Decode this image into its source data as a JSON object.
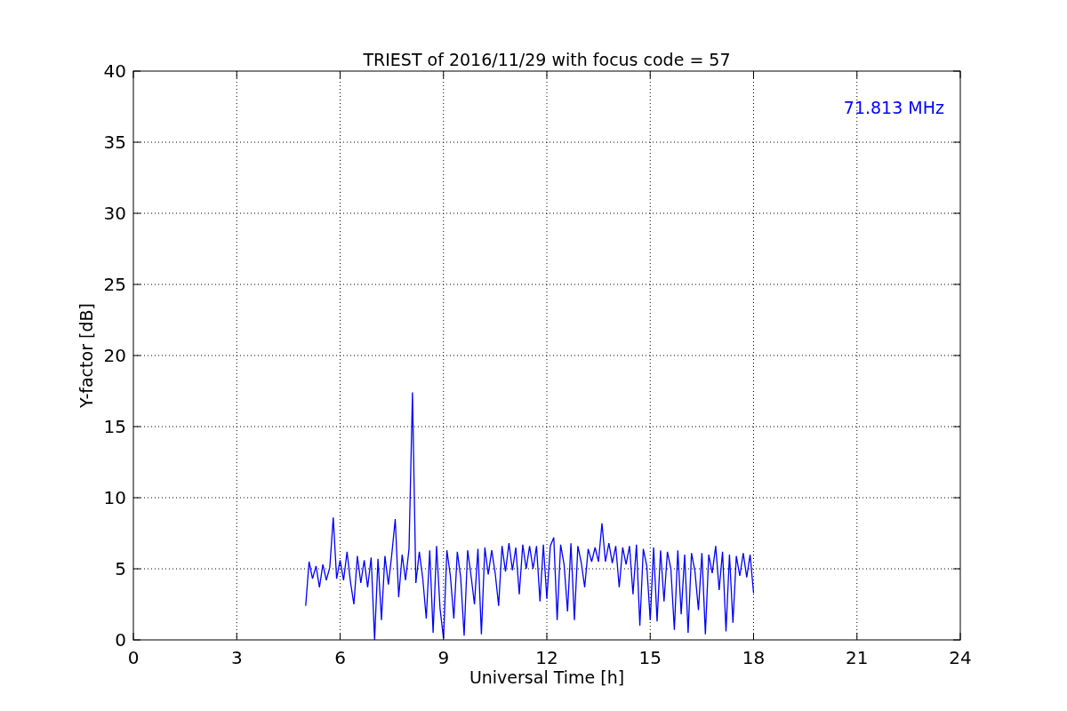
{
  "chart_data": {
    "type": "line",
    "title": "TRIEST of 2016/11/29 with focus code = 57",
    "xlabel": "Universal Time [h]",
    "ylabel": "Y-factor [dB]",
    "xlim": [
      0,
      24
    ],
    "ylim": [
      0,
      40
    ],
    "grid": true,
    "xticks": [
      0,
      3,
      6,
      9,
      12,
      15,
      18,
      21,
      24
    ],
    "yticks": [
      0,
      5,
      10,
      15,
      20,
      25,
      30,
      35,
      40
    ],
    "x": [
      5.0,
      5.1,
      5.2,
      5.3,
      5.4,
      5.5,
      5.6,
      5.7,
      5.8,
      5.9,
      6.0,
      6.1,
      6.2,
      6.3,
      6.4,
      6.5,
      6.6,
      6.7,
      6.8,
      6.9,
      7.0,
      7.1,
      7.2,
      7.3,
      7.4,
      7.5,
      7.6,
      7.7,
      7.8,
      7.9,
      8.0,
      8.1,
      8.2,
      8.3,
      8.4,
      8.5,
      8.6,
      8.7,
      8.8,
      8.9,
      9.0,
      9.1,
      9.2,
      9.3,
      9.4,
      9.5,
      9.6,
      9.7,
      9.8,
      9.9,
      10.0,
      10.1,
      10.2,
      10.3,
      10.4,
      10.5,
      10.6,
      10.7,
      10.8,
      10.9,
      11.0,
      11.1,
      11.2,
      11.3,
      11.4,
      11.5,
      11.6,
      11.7,
      11.8,
      11.9,
      12.0,
      12.1,
      12.2,
      12.3,
      12.4,
      12.5,
      12.6,
      12.7,
      12.8,
      12.9,
      13.0,
      13.1,
      13.2,
      13.3,
      13.4,
      13.5,
      13.6,
      13.7,
      13.8,
      13.9,
      14.0,
      14.1,
      14.2,
      14.3,
      14.4,
      14.5,
      14.6,
      14.7,
      14.8,
      14.9,
      15.0,
      15.1,
      15.2,
      15.3,
      15.4,
      15.5,
      15.6,
      15.7,
      15.8,
      15.9,
      16.0,
      16.1,
      16.2,
      16.3,
      16.4,
      16.5,
      16.6,
      16.7,
      16.8,
      16.9,
      17.0,
      17.1,
      17.2,
      17.3,
      17.4,
      17.5,
      17.6,
      17.7,
      17.8,
      17.9,
      18.0
    ],
    "series": [
      {
        "name": "71.813 MHz",
        "color": "#0000ff",
        "values": [
          2.4,
          5.5,
          4.3,
          5.2,
          3.7,
          5.3,
          4.2,
          5.1,
          8.6,
          4.3,
          5.6,
          4.2,
          6.2,
          4.1,
          2.5,
          5.9,
          4.0,
          5.6,
          3.7,
          5.8,
          0.0,
          5.7,
          1.4,
          5.9,
          3.9,
          6.0,
          8.5,
          3.0,
          6.0,
          4.2,
          6.4,
          17.4,
          4.0,
          6.2,
          4.3,
          1.5,
          6.3,
          0.5,
          6.6,
          2.2,
          0.1,
          6.3,
          4.5,
          1.5,
          6.2,
          4.4,
          0.3,
          6.3,
          4.5,
          2.5,
          6.4,
          0.4,
          6.5,
          4.6,
          6.3,
          4.7,
          2.4,
          6.6,
          4.8,
          6.8,
          4.9,
          6.5,
          3.2,
          6.7,
          5.0,
          6.6,
          5.0,
          6.6,
          2.7,
          6.7,
          2.9,
          6.6,
          7.2,
          1.4,
          6.7,
          5.3,
          2.0,
          6.8,
          1.4,
          6.6,
          5.4,
          3.7,
          6.4,
          5.5,
          6.5,
          5.5,
          8.2,
          5.5,
          6.8,
          5.4,
          6.6,
          3.7,
          6.5,
          5.3,
          6.6,
          3.2,
          6.7,
          1.0,
          6.4,
          5.2,
          1.4,
          6.5,
          1.3,
          6.3,
          2.7,
          6.2,
          5.0,
          0.7,
          6.3,
          1.8,
          6.0,
          0.5,
          6.1,
          4.8,
          2.1,
          6.1,
          0.4,
          6.0,
          4.7,
          6.6,
          3.5,
          6.2,
          0.6,
          6.0,
          1.2,
          5.9,
          4.5,
          6.1,
          4.4,
          6.0,
          3.3
        ]
      }
    ]
  }
}
